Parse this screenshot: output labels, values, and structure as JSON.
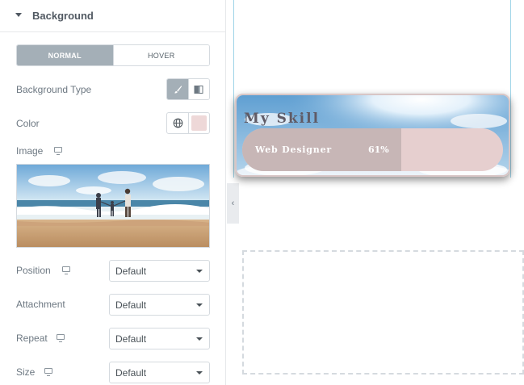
{
  "panel": {
    "section_title": "Background",
    "tabs": [
      {
        "label": "NORMAL",
        "active": true
      },
      {
        "label": "HOVER",
        "active": false
      }
    ],
    "fields": {
      "background_type": "Background Type",
      "color": "Color",
      "image": "Image",
      "position": {
        "label": "Position",
        "value": "Default"
      },
      "attachment": {
        "label": "Attachment",
        "value": "Default"
      },
      "repeat": {
        "label": "Repeat",
        "value": "Default"
      },
      "size": {
        "label": "Size",
        "value": "Default"
      }
    },
    "color_value": "#eed8d8",
    "icons": {
      "caret": "caret-down-icon",
      "classic": "brush-icon",
      "gradient": "gradient-icon",
      "global": "globe-icon",
      "responsive": "desktop-icon",
      "collapse": "chevron-left-icon"
    }
  },
  "canvas": {
    "widget": {
      "title": "My Skill",
      "skill_label": "Web Designer",
      "percent_text": "61%",
      "progress": 0.61
    },
    "colors": {
      "bar_fill": "#c7b6b6",
      "bar_track": "#e6cfcf",
      "guide": "#9fd4e8"
    }
  }
}
